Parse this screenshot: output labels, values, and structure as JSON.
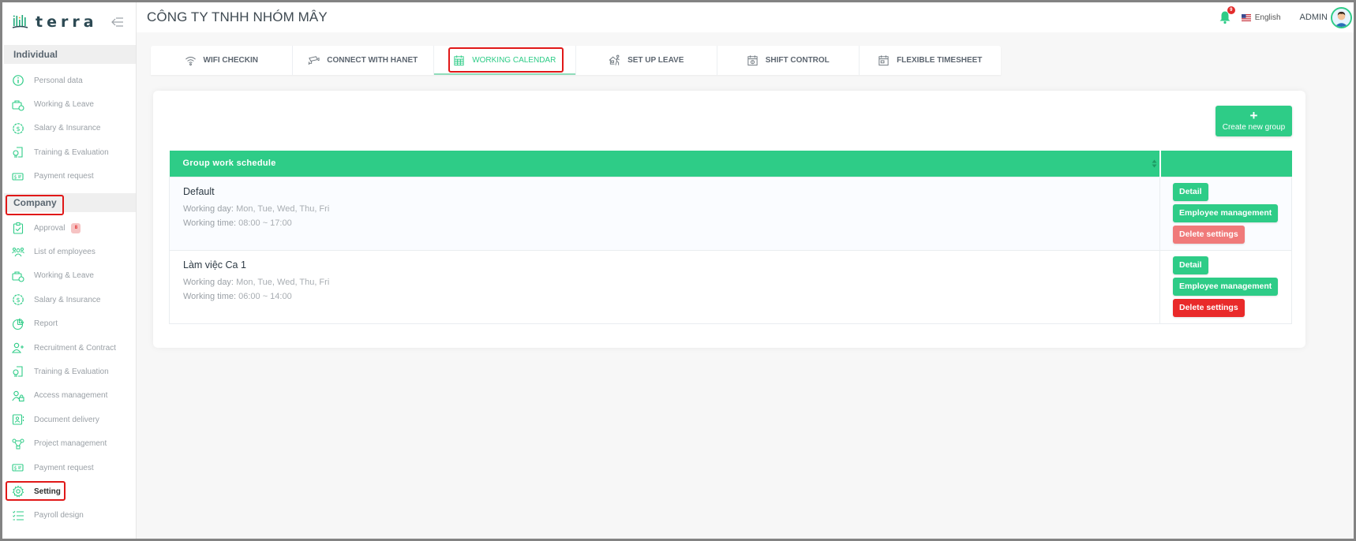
{
  "app": {
    "logo_text": "terra",
    "company_name": "CÔNG TY TNHH NHÓM MÂY"
  },
  "header": {
    "notifications_count": "9",
    "language": "English",
    "user": "ADMIN"
  },
  "sidebar": {
    "sections": [
      {
        "title": "Individual",
        "items": [
          {
            "label": "Personal data",
            "icon": "info-icon"
          },
          {
            "label": "Working & Leave",
            "icon": "briefcase-clock-icon"
          },
          {
            "label": "Salary & Insurance",
            "icon": "dollar-badge-icon"
          },
          {
            "label": "Training & Evaluation",
            "icon": "certificate-icon"
          },
          {
            "label": "Payment request",
            "icon": "payment-card-icon"
          }
        ]
      },
      {
        "title": "Company",
        "items": [
          {
            "label": "Approval",
            "icon": "clipboard-check-icon",
            "badge": "8"
          },
          {
            "label": "List of employees",
            "icon": "users-icon"
          },
          {
            "label": "Working & Leave",
            "icon": "briefcase-clock-icon"
          },
          {
            "label": "Salary & Insurance",
            "icon": "dollar-badge-icon"
          },
          {
            "label": "Report",
            "icon": "pie-chart-icon"
          },
          {
            "label": "Recruitment & Contract",
            "icon": "user-plus-icon"
          },
          {
            "label": "Training & Evaluation",
            "icon": "certificate-icon"
          },
          {
            "label": "Access management",
            "icon": "user-lock-icon"
          },
          {
            "label": "Document delivery",
            "icon": "id-card-icon"
          },
          {
            "label": "Project management",
            "icon": "nodes-icon"
          },
          {
            "label": "Payment request",
            "icon": "payment-card-icon"
          },
          {
            "label": "Setting",
            "icon": "gear-icon",
            "active": true
          },
          {
            "label": "Payroll design",
            "icon": "checklist-icon"
          }
        ]
      }
    ]
  },
  "tabs": [
    {
      "label": "WIFI CHECKIN",
      "icon": "wifi-icon"
    },
    {
      "label": "CONNECT WITH HANET",
      "icon": "camera-icon"
    },
    {
      "label": "WORKING CALENDAR",
      "icon": "calendar-icon",
      "active": true
    },
    {
      "label": "SET UP LEAVE",
      "icon": "leave-icon"
    },
    {
      "label": "SHIFT CONTROL",
      "icon": "calendar-gear-icon"
    },
    {
      "label": "FLEXIBLE TIMESHEET",
      "icon": "calendar-box-icon"
    }
  ],
  "main": {
    "create_button": "Create new group",
    "table": {
      "header": "Group work schedule",
      "rows": [
        {
          "name": "Default",
          "working_day_label": "Working day:",
          "working_day": "Mon, Tue, Wed, Thu, Fri",
          "working_time_label": "Working time:",
          "working_time": "08:00 ~ 17:00",
          "actions": {
            "detail": "Detail",
            "employees": "Employee management",
            "delete": "Delete settings"
          },
          "delete_enabled": false
        },
        {
          "name": "Làm việc Ca 1",
          "working_day_label": "Working day:",
          "working_day": "Mon, Tue, Wed, Thu, Fri",
          "working_time_label": "Working time:",
          "working_time": "06:00 ~ 14:00",
          "actions": {
            "detail": "Detail",
            "employees": "Employee management",
            "delete": "Delete settings"
          },
          "delete_enabled": true
        }
      ]
    }
  },
  "colors": {
    "accent": "#2ecc87",
    "danger": "#e92a2a",
    "danger_light": "#f07a7a",
    "highlight": "#e01818"
  }
}
